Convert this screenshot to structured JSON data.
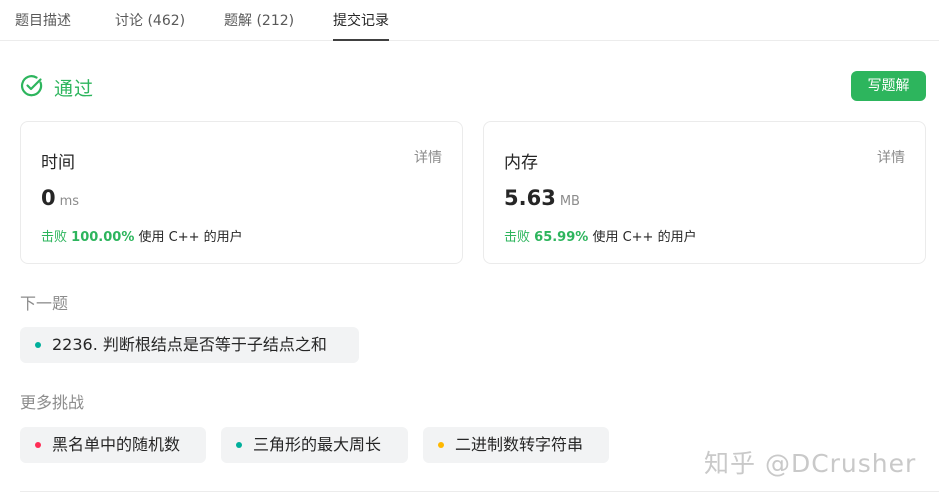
{
  "tabs": [
    {
      "label": "题目描述"
    },
    {
      "label": "讨论 (462)"
    },
    {
      "label": "题解 (212)"
    },
    {
      "label": "提交记录",
      "active": true
    }
  ],
  "status": {
    "text": "通过",
    "icon": "check-circle-icon",
    "color": "#2db55d"
  },
  "write_solution_label": "写题解",
  "cards": {
    "time": {
      "title": "时间",
      "detail": "详情",
      "value": "0",
      "unit": "ms",
      "beat_label": "击败",
      "beat_pct": "100.00%",
      "beat_desc": "使用 C++ 的用户"
    },
    "memory": {
      "title": "内存",
      "detail": "详情",
      "value": "5.63",
      "unit": "MB",
      "beat_label": "击败",
      "beat_pct": "65.99%",
      "beat_desc": "使用 C++ 的用户"
    }
  },
  "next": {
    "label": "下一题",
    "problem": {
      "text": "2236. 判断根结点是否等于子结点之和",
      "dot_color": "#00af9b"
    }
  },
  "more": {
    "label": "更多挑战",
    "items": [
      {
        "text": "黑名单中的随机数",
        "dot_color": "#ff2d55"
      },
      {
        "text": "三角形的最大周长",
        "dot_color": "#00af9b"
      },
      {
        "text": "二进制数转字符串",
        "dot_color": "#ffb800"
      }
    ]
  },
  "watermark": "知乎 @DCrusher"
}
